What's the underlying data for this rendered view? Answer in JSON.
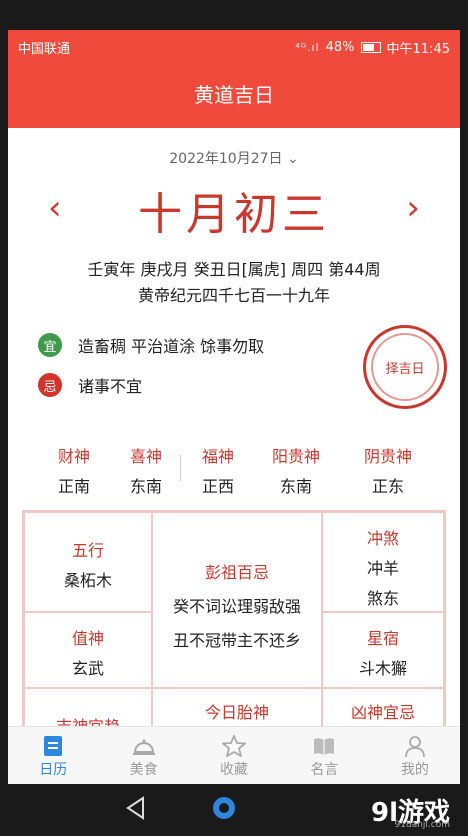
{
  "status": {
    "carrier": "中国联通",
    "signal": "⁴ᴳ.ıl",
    "battery": "48%",
    "time": "中午11:45"
  },
  "header": {
    "title": "黄道吉日"
  },
  "date": {
    "selected": "2022年10月27日",
    "lunar": "十月初三",
    "ganzhi": "壬寅年 庚戌月 癸丑日[属虎] 周四 第44周",
    "era": "黄帝纪元四千七百一十九年"
  },
  "yi": {
    "badge": "宜",
    "text": "造畜稠 平治道涂 馀事勿取"
  },
  "ji": {
    "badge": "忌",
    "text": "诸事不宜"
  },
  "seal": {
    "text": "择吉日"
  },
  "gods": [
    {
      "name": "财神",
      "dir": "正南"
    },
    {
      "name": "喜神",
      "dir": "东南"
    },
    {
      "name": "福神",
      "dir": "正西"
    },
    {
      "name": "阳贵神",
      "dir": "东南"
    },
    {
      "name": "阴贵神",
      "dir": "正东"
    }
  ],
  "grid": {
    "wuxing": {
      "title": "五行",
      "value": "桑柘木"
    },
    "pengzu": {
      "title": "彭祖百忌",
      "line1": "癸不词讼理弱敌强",
      "line2": "丑不冠带主不还乡"
    },
    "chongsha": {
      "title": "冲煞",
      "line1": "冲羊",
      "line2": "煞东"
    },
    "zhishen": {
      "title": "值神",
      "value": "玄武"
    },
    "xingxiu": {
      "title": "星宿",
      "value": "斗木獬"
    },
    "jishen": {
      "title": "吉神宜趋"
    },
    "taishen": {
      "title": "今日胎神"
    },
    "xiongshen": {
      "title": "凶神宜忌"
    }
  },
  "tabs": [
    {
      "label": "日历",
      "icon": "calendar-icon"
    },
    {
      "label": "美食",
      "icon": "food-cloche-icon"
    },
    {
      "label": "收藏",
      "icon": "star-icon"
    },
    {
      "label": "名言",
      "icon": "book-icon"
    },
    {
      "label": "我的",
      "icon": "person-icon"
    }
  ],
  "watermark": {
    "main": "9l游戏",
    "sub": "91danji.com"
  },
  "colors": {
    "primary": "#ef4a3c",
    "accent_red": "#c8382d",
    "tab_active": "#2f86e0",
    "yi_green": "#3f9a4b"
  }
}
